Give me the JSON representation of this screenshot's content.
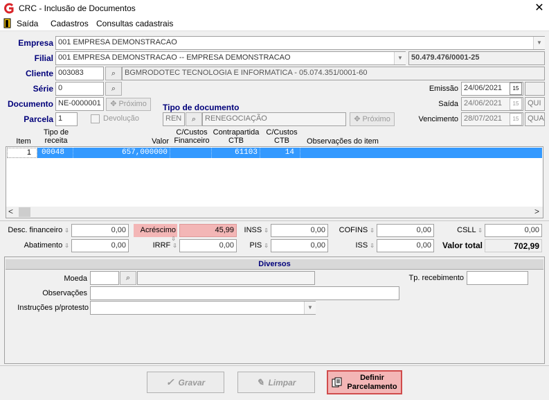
{
  "window": {
    "title": "CRC - Inclusão de Documentos",
    "close": "✕"
  },
  "menu": [
    "Saída",
    "Cadastros",
    "Consultas cadastrais"
  ],
  "form": {
    "empresa_label": "Empresa",
    "empresa_value": "001 EMPRESA DEMONSTRACAO",
    "filial_label": "Filial",
    "filial_value": "001 EMPRESA DEMONSTRACAO -- EMPRESA DEMONSTRACAO",
    "filial_cnpj": "50.479.476/0001-25",
    "cliente_label": "Cliente",
    "cliente_code": "003083",
    "cliente_name": "BGMRODOTEC TECNOLOGIA  E INFORMATICA - 05.074.351/0001-60",
    "serie_label": "Série",
    "serie_value": "0",
    "documento_label": "Documento",
    "documento_value": "NE-0000001",
    "proximo_label": "Próximo",
    "tipo_doc_label": "Tipo de documento",
    "tipo_doc_code": "REN",
    "tipo_doc_name": "RENEGOCIAÇÃO",
    "parcela_label": "Parcela",
    "parcela_value": "1",
    "devolucao_label": "Devolução",
    "emissao_label": "Emissão",
    "emissao_value": "24/06/2021",
    "saida_label": "Saída",
    "saida_value": "24/06/2021",
    "saida_day": "QUI",
    "vencimento_label": "Vencimento",
    "vencimento_value": "28/07/2021",
    "vencimento_day": "QUA",
    "cal_icon": "15"
  },
  "grid": {
    "headers": {
      "item": "Item",
      "tipo_receita": "Tipo de\nreceita",
      "valor": "Valor",
      "cc_financeiro": "C/Custos\nFinanceiro",
      "contrapartida": "Contrapartida\nCTB",
      "cc_ctb": "C/Custos\nCTB",
      "observacoes": "Observações do item"
    },
    "rows": [
      {
        "item": "1",
        "tipo_receita": "00048",
        "valor": "657,000000",
        "cc_financeiro": "",
        "contrapartida": "61103",
        "cc_ctb": "14",
        "observacoes": ""
      }
    ],
    "scroll_left": "<",
    "scroll_right": ">"
  },
  "totals": {
    "desc_financeiro_label": "Desc. financeiro",
    "desc_financeiro": "0,00",
    "acrescimo_label": "Acréscimo",
    "acrescimo": "45,99",
    "inss_label": "INSS",
    "inss": "0,00",
    "cofins_label": "COFINS",
    "cofins": "0,00",
    "csll_label": "CSLL",
    "csll": "0,00",
    "abatimento_label": "Abatimento",
    "abatimento": "0,00",
    "irrf_label": "IRRF",
    "irrf": "0,00",
    "pis_label": "PIS",
    "pis": "0,00",
    "iss_label": "ISS",
    "iss": "0,00",
    "valor_total_label": "Valor total",
    "valor_total": "702,99"
  },
  "diversos": {
    "title": "Diversos",
    "moeda_label": "Moeda",
    "moeda_value": "",
    "tp_recebimento_label": "Tp. recebimento",
    "observacoes_label": "Observações",
    "instrucoes_label": "Instruções p/protesto"
  },
  "buttons": {
    "gravar": "Gravar",
    "limpar": "Limpar",
    "definir_line1": "Definir",
    "definir_line2": "Parcelamento"
  },
  "colors": {
    "selection": "#3399ff",
    "highlight": "#f3b6b6",
    "label_blue": "#00007a"
  }
}
